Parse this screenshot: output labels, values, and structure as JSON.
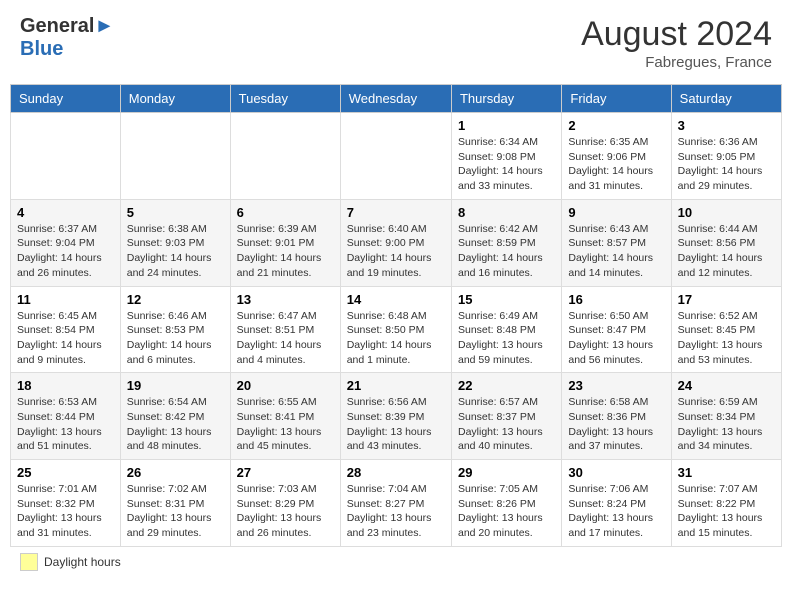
{
  "header": {
    "logo_line1": "General",
    "logo_line2": "Blue",
    "month_year": "August 2024",
    "location": "Fabregues, France"
  },
  "footer": {
    "legend_label": "Daylight hours"
  },
  "days_of_week": [
    "Sunday",
    "Monday",
    "Tuesday",
    "Wednesday",
    "Thursday",
    "Friday",
    "Saturday"
  ],
  "weeks": [
    [
      {
        "day": "",
        "info": ""
      },
      {
        "day": "",
        "info": ""
      },
      {
        "day": "",
        "info": ""
      },
      {
        "day": "",
        "info": ""
      },
      {
        "day": "1",
        "info": "Sunrise: 6:34 AM\nSunset: 9:08 PM\nDaylight: 14 hours and 33 minutes."
      },
      {
        "day": "2",
        "info": "Sunrise: 6:35 AM\nSunset: 9:06 PM\nDaylight: 14 hours and 31 minutes."
      },
      {
        "day": "3",
        "info": "Sunrise: 6:36 AM\nSunset: 9:05 PM\nDaylight: 14 hours and 29 minutes."
      }
    ],
    [
      {
        "day": "4",
        "info": "Sunrise: 6:37 AM\nSunset: 9:04 PM\nDaylight: 14 hours and 26 minutes."
      },
      {
        "day": "5",
        "info": "Sunrise: 6:38 AM\nSunset: 9:03 PM\nDaylight: 14 hours and 24 minutes."
      },
      {
        "day": "6",
        "info": "Sunrise: 6:39 AM\nSunset: 9:01 PM\nDaylight: 14 hours and 21 minutes."
      },
      {
        "day": "7",
        "info": "Sunrise: 6:40 AM\nSunset: 9:00 PM\nDaylight: 14 hours and 19 minutes."
      },
      {
        "day": "8",
        "info": "Sunrise: 6:42 AM\nSunset: 8:59 PM\nDaylight: 14 hours and 16 minutes."
      },
      {
        "day": "9",
        "info": "Sunrise: 6:43 AM\nSunset: 8:57 PM\nDaylight: 14 hours and 14 minutes."
      },
      {
        "day": "10",
        "info": "Sunrise: 6:44 AM\nSunset: 8:56 PM\nDaylight: 14 hours and 12 minutes."
      }
    ],
    [
      {
        "day": "11",
        "info": "Sunrise: 6:45 AM\nSunset: 8:54 PM\nDaylight: 14 hours and 9 minutes."
      },
      {
        "day": "12",
        "info": "Sunrise: 6:46 AM\nSunset: 8:53 PM\nDaylight: 14 hours and 6 minutes."
      },
      {
        "day": "13",
        "info": "Sunrise: 6:47 AM\nSunset: 8:51 PM\nDaylight: 14 hours and 4 minutes."
      },
      {
        "day": "14",
        "info": "Sunrise: 6:48 AM\nSunset: 8:50 PM\nDaylight: 14 hours and 1 minute."
      },
      {
        "day": "15",
        "info": "Sunrise: 6:49 AM\nSunset: 8:48 PM\nDaylight: 13 hours and 59 minutes."
      },
      {
        "day": "16",
        "info": "Sunrise: 6:50 AM\nSunset: 8:47 PM\nDaylight: 13 hours and 56 minutes."
      },
      {
        "day": "17",
        "info": "Sunrise: 6:52 AM\nSunset: 8:45 PM\nDaylight: 13 hours and 53 minutes."
      }
    ],
    [
      {
        "day": "18",
        "info": "Sunrise: 6:53 AM\nSunset: 8:44 PM\nDaylight: 13 hours and 51 minutes."
      },
      {
        "day": "19",
        "info": "Sunrise: 6:54 AM\nSunset: 8:42 PM\nDaylight: 13 hours and 48 minutes."
      },
      {
        "day": "20",
        "info": "Sunrise: 6:55 AM\nSunset: 8:41 PM\nDaylight: 13 hours and 45 minutes."
      },
      {
        "day": "21",
        "info": "Sunrise: 6:56 AM\nSunset: 8:39 PM\nDaylight: 13 hours and 43 minutes."
      },
      {
        "day": "22",
        "info": "Sunrise: 6:57 AM\nSunset: 8:37 PM\nDaylight: 13 hours and 40 minutes."
      },
      {
        "day": "23",
        "info": "Sunrise: 6:58 AM\nSunset: 8:36 PM\nDaylight: 13 hours and 37 minutes."
      },
      {
        "day": "24",
        "info": "Sunrise: 6:59 AM\nSunset: 8:34 PM\nDaylight: 13 hours and 34 minutes."
      }
    ],
    [
      {
        "day": "25",
        "info": "Sunrise: 7:01 AM\nSunset: 8:32 PM\nDaylight: 13 hours and 31 minutes."
      },
      {
        "day": "26",
        "info": "Sunrise: 7:02 AM\nSunset: 8:31 PM\nDaylight: 13 hours and 29 minutes."
      },
      {
        "day": "27",
        "info": "Sunrise: 7:03 AM\nSunset: 8:29 PM\nDaylight: 13 hours and 26 minutes."
      },
      {
        "day": "28",
        "info": "Sunrise: 7:04 AM\nSunset: 8:27 PM\nDaylight: 13 hours and 23 minutes."
      },
      {
        "day": "29",
        "info": "Sunrise: 7:05 AM\nSunset: 8:26 PM\nDaylight: 13 hours and 20 minutes."
      },
      {
        "day": "30",
        "info": "Sunrise: 7:06 AM\nSunset: 8:24 PM\nDaylight: 13 hours and 17 minutes."
      },
      {
        "day": "31",
        "info": "Sunrise: 7:07 AM\nSunset: 8:22 PM\nDaylight: 13 hours and 15 minutes."
      }
    ]
  ]
}
